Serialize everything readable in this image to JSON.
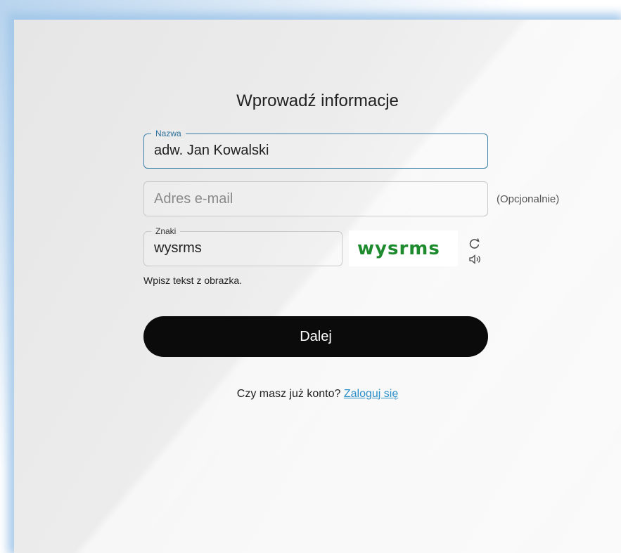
{
  "form": {
    "title": "Wprowadź informacje",
    "name_field": {
      "label": "Nazwa",
      "value": "adw. Jan Kowalski"
    },
    "email_field": {
      "placeholder": "Adres e-mail",
      "optional_label": "(Opcjonalnie)"
    },
    "captcha": {
      "label": "Znaki",
      "value": "wysrms",
      "image_text": "wysrms",
      "hint": "Wpisz tekst z obrazka.",
      "refresh_icon": "refresh-icon",
      "audio_icon": "speaker-icon"
    },
    "next_button": "Dalej",
    "login_prompt": "Czy masz już konto?",
    "login_link": "Zaloguj się"
  },
  "colors": {
    "accent": "#3a7fa5",
    "link": "#2b8fc8",
    "button": "#0b0b0b",
    "captcha_text": "#1e8a2e"
  }
}
